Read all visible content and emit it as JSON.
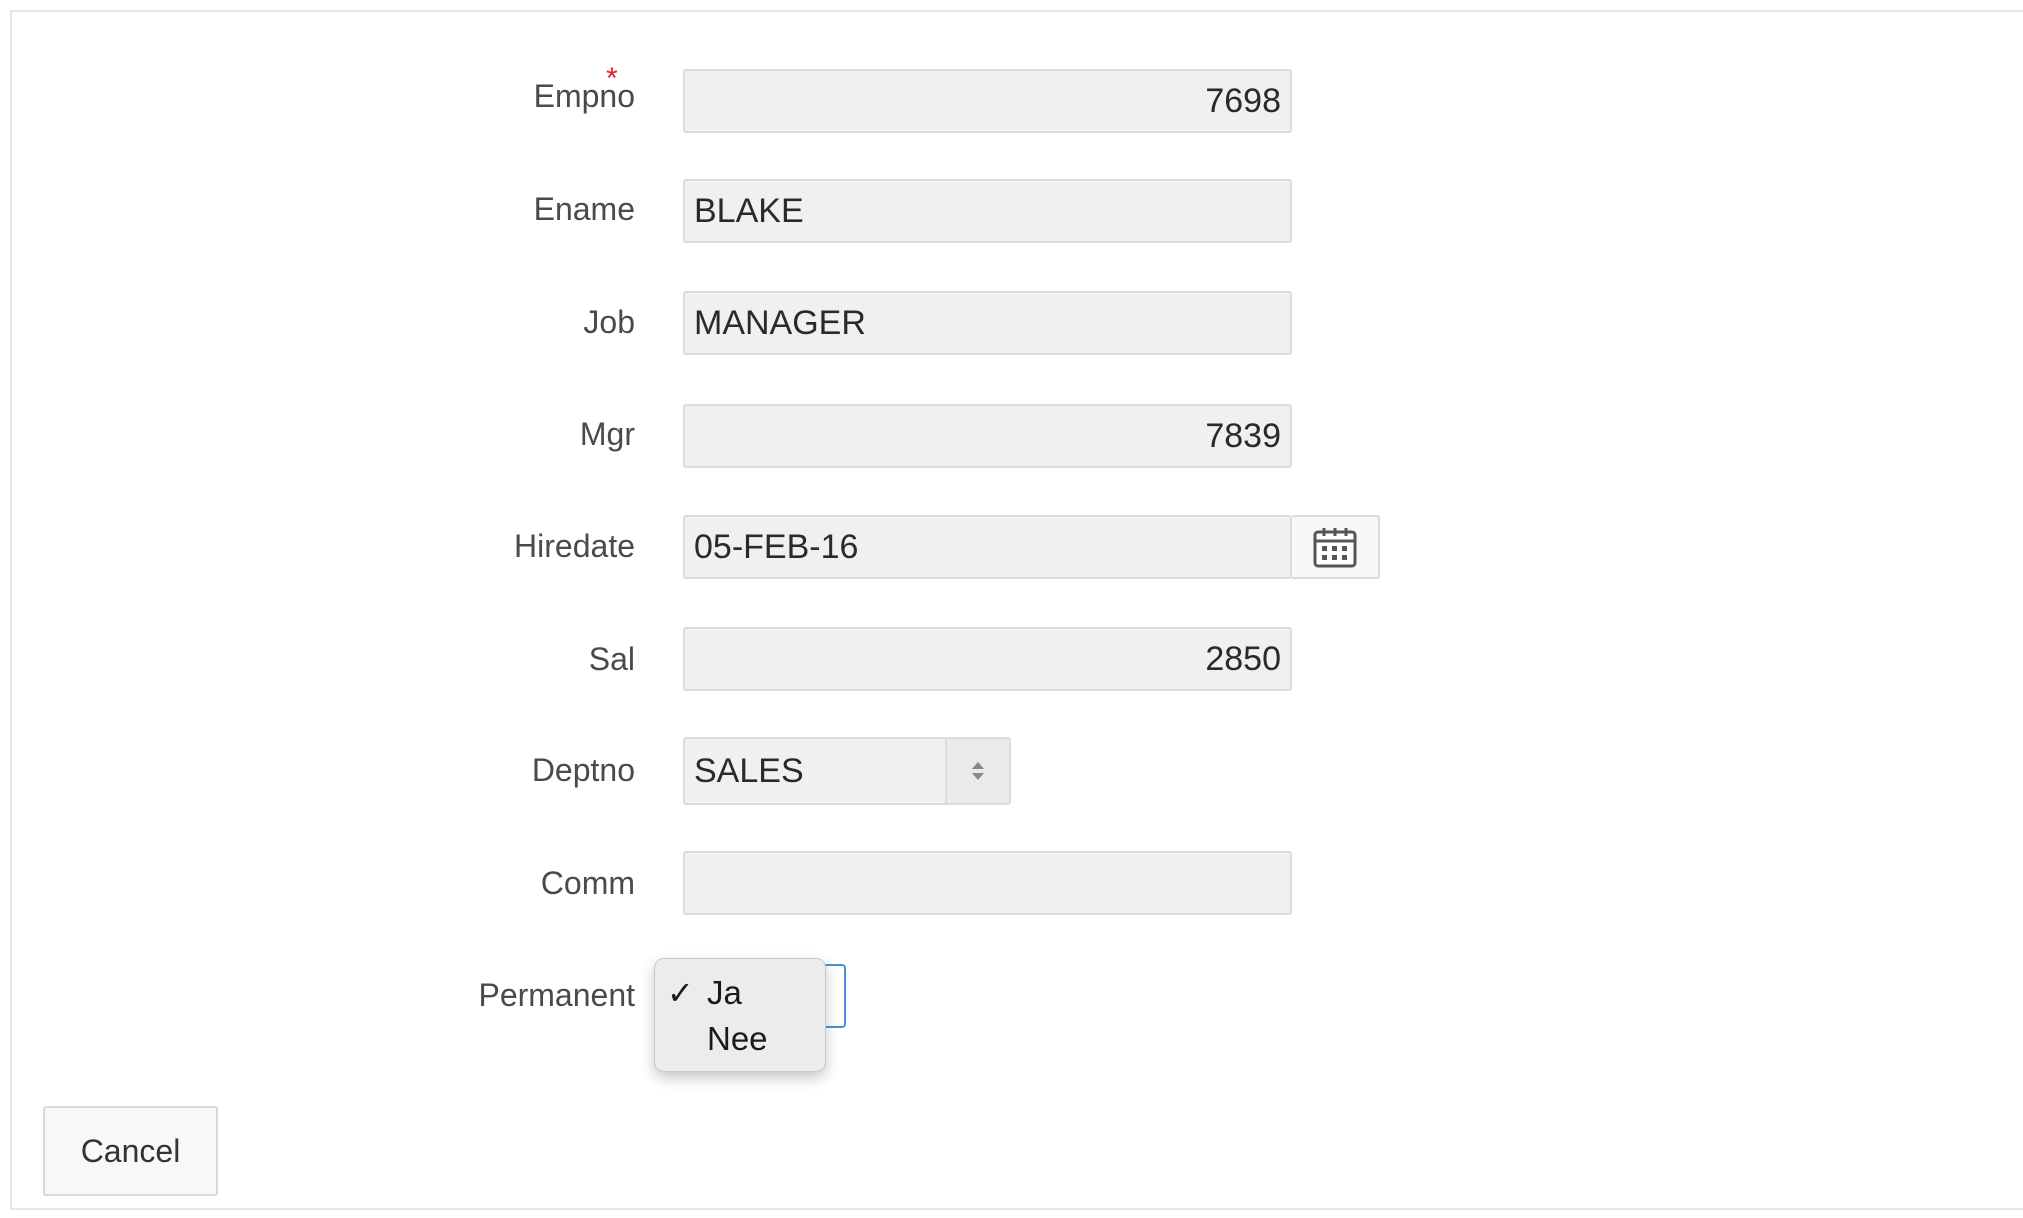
{
  "form": {
    "fields": {
      "empno": {
        "label": "Empno",
        "value": "7698",
        "required": true
      },
      "ename": {
        "label": "Ename",
        "value": "BLAKE"
      },
      "job": {
        "label": "Job",
        "value": "MANAGER"
      },
      "mgr": {
        "label": "Mgr",
        "value": "7839"
      },
      "hiredate": {
        "label": "Hiredate",
        "value": "05-FEB-16"
      },
      "sal": {
        "label": "Sal",
        "value": "2850"
      },
      "deptno": {
        "label": "Deptno",
        "value": "SALES"
      },
      "comm": {
        "label": "Comm",
        "value": ""
      },
      "permanent": {
        "label": "Permanent",
        "options": [
          "Ja",
          "Nee"
        ],
        "selected": "Ja"
      }
    },
    "required_marker": "*",
    "check_mark": "✓",
    "cancel_label": "Cancel"
  },
  "icons": {
    "calendar": "calendar-icon",
    "select_arrows": "up-down-arrows-icon"
  },
  "colors": {
    "required": "#e8202a",
    "focus_border": "#4a90d9",
    "field_bg": "#f0f0f0"
  }
}
